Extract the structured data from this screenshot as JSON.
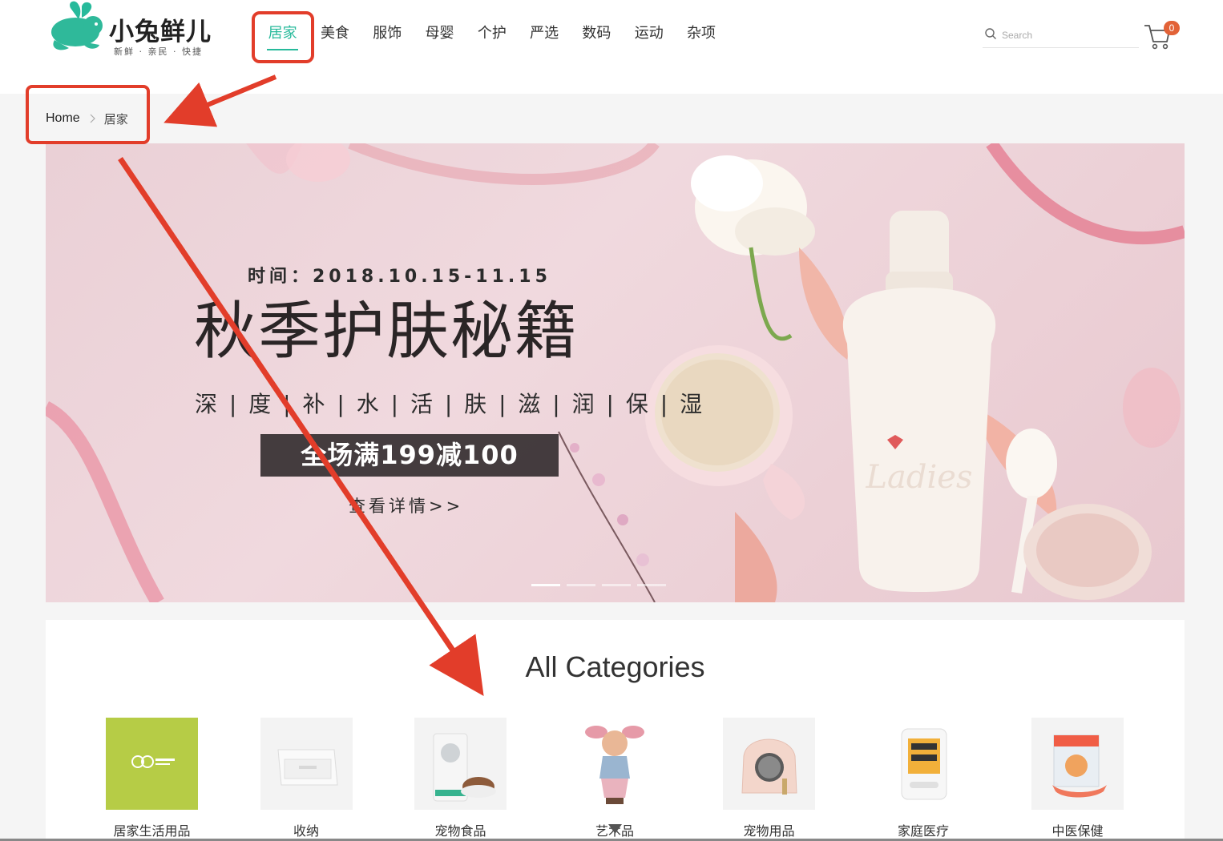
{
  "logo": {
    "title": "小兔鲜儿",
    "subtitle": "新鲜 · 亲民 · 快捷"
  },
  "nav": {
    "items": [
      {
        "label": "居家",
        "active": true
      },
      {
        "label": "美食"
      },
      {
        "label": "服饰"
      },
      {
        "label": "母婴"
      },
      {
        "label": "个护"
      },
      {
        "label": "严选"
      },
      {
        "label": "数码"
      },
      {
        "label": "运动"
      },
      {
        "label": "杂项"
      }
    ]
  },
  "search": {
    "placeholder": "Search"
  },
  "cart": {
    "count": "0"
  },
  "breadcrumb": {
    "home": "Home",
    "current": "居家"
  },
  "banner": {
    "date": "时间：2018.10.15-11.15",
    "headline": "秋季护肤秘籍",
    "tagline": "深 | 度 | 补 | 水 | 活 | 肤 | 滋 | 润 | 保 | 湿",
    "promo": "全场满199减100",
    "more": "查看详情>>",
    "bottle_brand": "Ladies",
    "slides": 4,
    "active_slide": 1
  },
  "categories": {
    "title": "All Categories",
    "items": [
      {
        "label": "居家生活用品"
      },
      {
        "label": "收纳"
      },
      {
        "label": "宠物食品"
      },
      {
        "label": "艺术品"
      },
      {
        "label": "宠物用品"
      },
      {
        "label": "家庭医疗"
      },
      {
        "label": "中医保健"
      }
    ]
  },
  "colors": {
    "accent": "#27ba9b",
    "badge": "#e26237",
    "annotation": "#e23d2a"
  }
}
